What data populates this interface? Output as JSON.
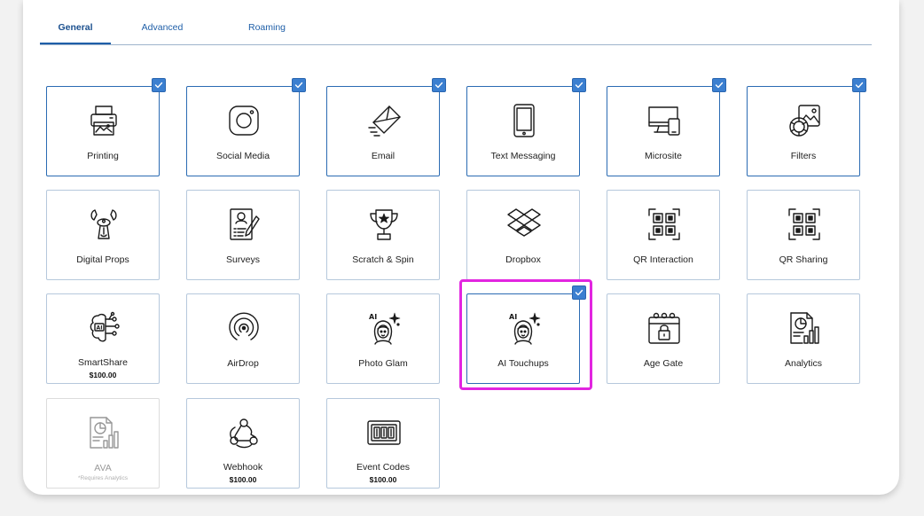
{
  "tabs": [
    {
      "label": "General",
      "active": true
    },
    {
      "label": "Advanced",
      "active": false
    },
    {
      "label": "Roaming",
      "active": false
    }
  ],
  "colors": {
    "accent": "#2b6bb3",
    "highlight": "#e225e0",
    "card_border": "#b6c8dc"
  },
  "cards": [
    {
      "label": "Printing",
      "icon": "printer-icon",
      "checked": true
    },
    {
      "label": "Social Media",
      "icon": "instagram-icon",
      "checked": true
    },
    {
      "label": "Email",
      "icon": "envelope-send-icon",
      "checked": true
    },
    {
      "label": "Text Messaging",
      "icon": "tablet-icon",
      "checked": true
    },
    {
      "label": "Microsite",
      "icon": "devices-icon",
      "checked": true
    },
    {
      "label": "Filters",
      "icon": "filters-icon",
      "checked": true
    },
    {
      "label": "Digital Props",
      "icon": "dog-face-icon",
      "checked": false
    },
    {
      "label": "Surveys",
      "icon": "survey-form-icon",
      "checked": false
    },
    {
      "label": "Scratch & Spin",
      "icon": "trophy-icon",
      "checked": false
    },
    {
      "label": "Dropbox",
      "icon": "dropbox-icon",
      "checked": false
    },
    {
      "label": "QR Interaction",
      "icon": "qr-code-icon",
      "checked": false
    },
    {
      "label": "QR Sharing",
      "icon": "qr-code-icon",
      "checked": false
    },
    {
      "label": "SmartShare",
      "icon": "ai-brain-icon",
      "checked": false,
      "price": "$100.00"
    },
    {
      "label": "AirDrop",
      "icon": "airdrop-icon",
      "checked": false
    },
    {
      "label": "Photo Glam",
      "icon": "ai-portrait-icon",
      "checked": false
    },
    {
      "label": "AI Touchups",
      "icon": "ai-portrait-icon",
      "checked": true,
      "highlighted": true
    },
    {
      "label": "Age Gate",
      "icon": "calendar-lock-icon",
      "checked": false
    },
    {
      "label": "Analytics",
      "icon": "analytics-report-icon",
      "checked": false
    },
    {
      "label": "AVA",
      "icon": "analytics-report-icon",
      "checked": false,
      "disabled": true,
      "note": "*Requires Analytics"
    },
    {
      "label": "Webhook",
      "icon": "webhook-icon",
      "checked": false,
      "price": "$100.00"
    },
    {
      "label": "Event Codes",
      "icon": "event-codes-icon",
      "checked": false,
      "price": "$100.00"
    }
  ]
}
